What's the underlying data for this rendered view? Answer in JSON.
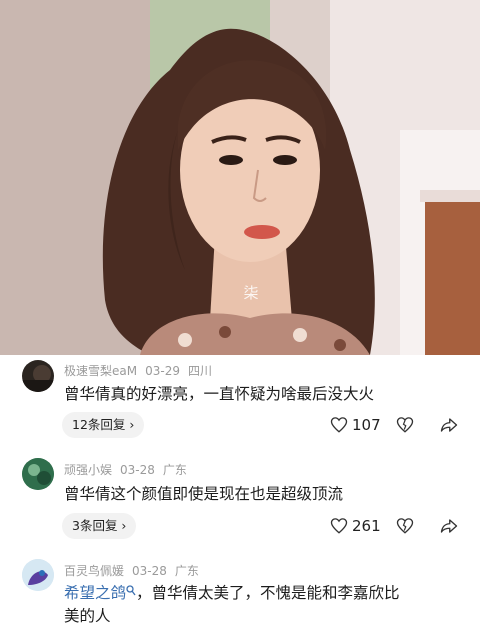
{
  "watermark": "柒",
  "comments": [
    {
      "username": "极速雪梨eaM",
      "date": "03-29",
      "location": "四川",
      "text": "曾华倩真的好漂亮，一直怀疑为啥最后没大火",
      "reply_label": "12条回复 ›",
      "likes": "107"
    },
    {
      "username": "顽强小娱",
      "date": "03-28",
      "location": "广东",
      "text": "曾华倩这个颜值即使是现在也是超级顶流",
      "reply_label": "3条回复 ›",
      "likes": "261"
    },
    {
      "username": "百灵鸟佩媛",
      "date": "03-28",
      "location": "广东",
      "mention": "希望之鸽",
      "text_line1": "，曾华倩太美了，不愧是能和李嘉欣比",
      "text_line2": "美的人"
    }
  ],
  "icons": {
    "like": "heart-icon",
    "dislike": "broken-heart-icon",
    "share": "share-arrow-icon",
    "mention_badge": "search-small-icon"
  }
}
